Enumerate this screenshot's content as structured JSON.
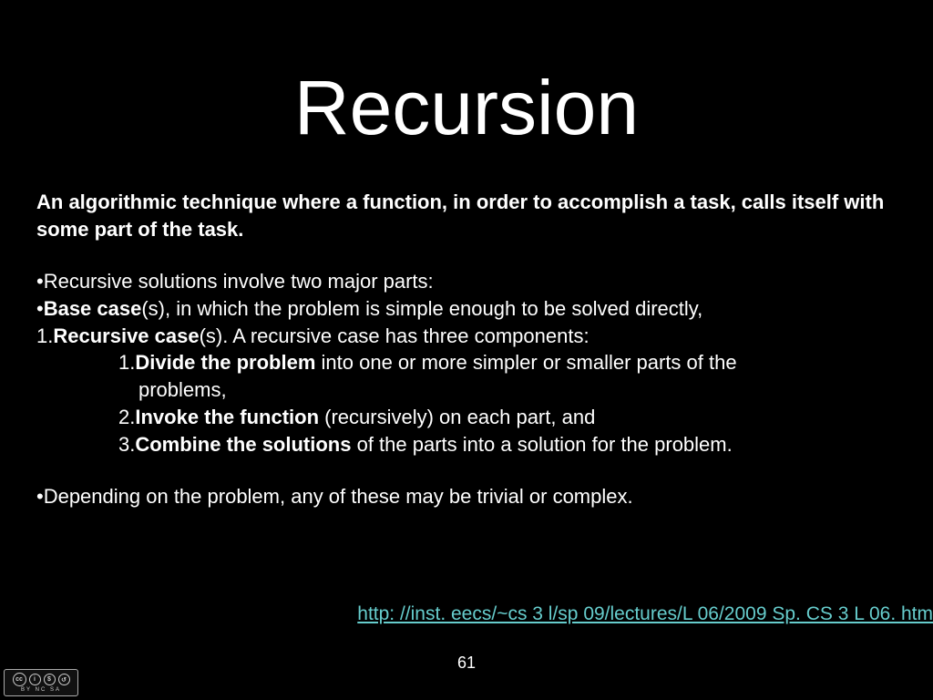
{
  "title": "Recursion",
  "subtitle": "An algorithmic technique where a function, in order to accomplish a task, calls itself with some part of the task.",
  "bullets": {
    "b1": "Recursive solutions involve two major parts:",
    "b2_bold": "Base case",
    "b2_rest": "(s), in which the problem is simple enough to be solved directly,",
    "b3_bold": "Recursive case",
    "b3_rest": "(s). A recursive case has three components:",
    "s1_bold": "Divide the problem",
    "s1_rest": " into one or more simpler or smaller parts of the",
    "s1_cont": "problems,",
    "s2_bold": "Invoke the function",
    "s2_rest": " (recursively) on each part, and",
    "s3_bold": "Combine the solutions",
    "s3_rest": " of the parts into a solution for the problem.",
    "b4": "Depending on the problem, any of these may be trivial or complex."
  },
  "marks": {
    "dot": "•",
    "n1": "1.",
    "n2": "2.",
    "n3": "3."
  },
  "link": "http: //inst. eecs/~cs 3 l/sp 09/lectures/L 06/2009 Sp. CS 3 L 06. htm",
  "pagenum": "61",
  "cc": {
    "main": "cc",
    "by": "BY",
    "nc": "NC",
    "sa": "SA",
    "labels": "BY  NC  SA"
  }
}
